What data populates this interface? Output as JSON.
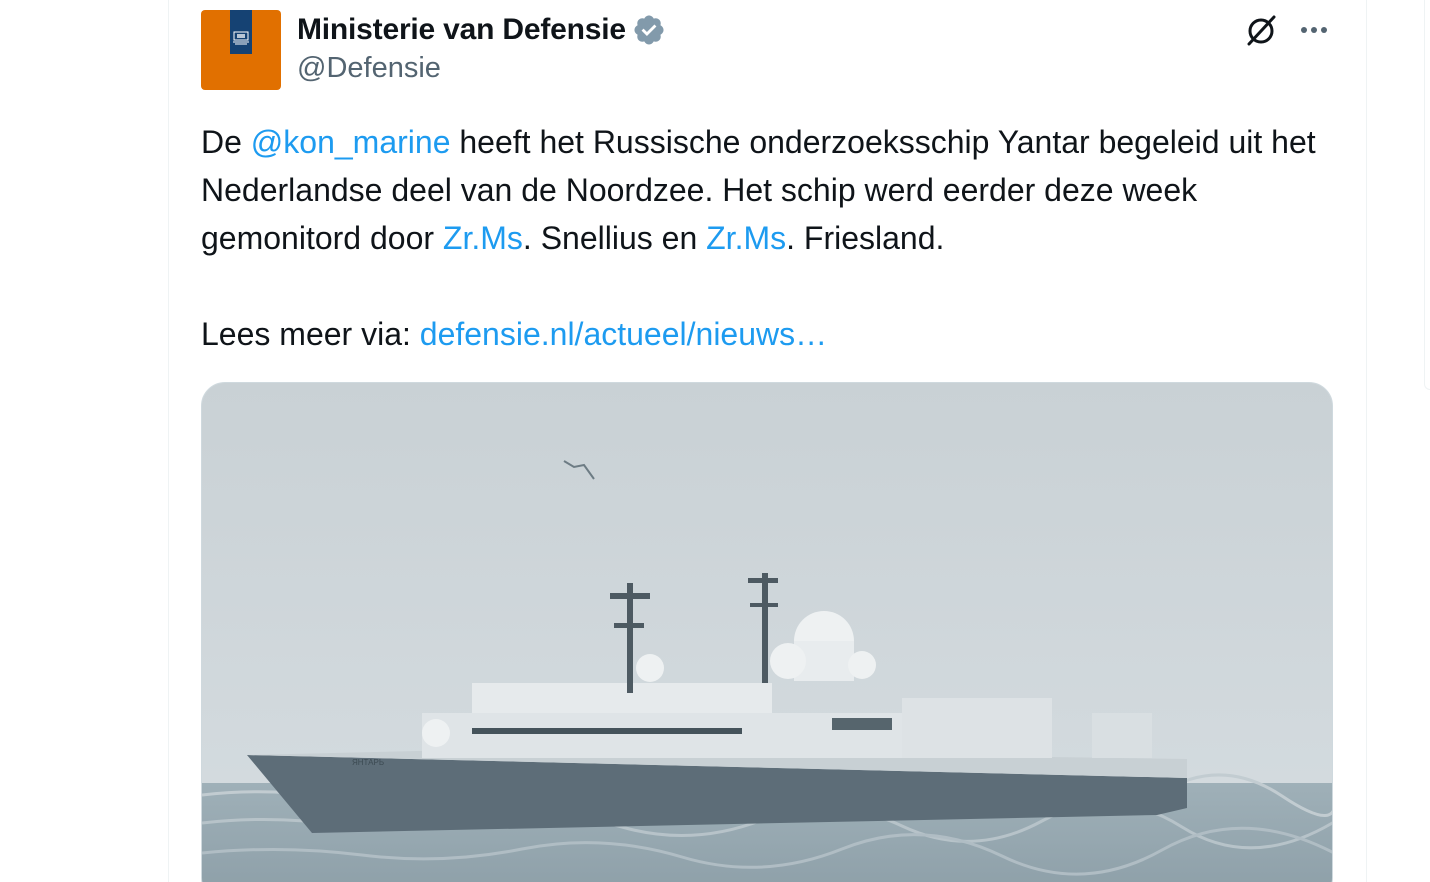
{
  "author": {
    "display_name": "Ministerie van Defensie",
    "handle": "@Defensie",
    "verified_icon": "verified-badge-icon",
    "avatar_color": "#e17000",
    "avatar_band_color": "#154273"
  },
  "actions": {
    "grok_icon": "grok-icon",
    "more_icon": "more-dots-icon"
  },
  "tweet": {
    "t1": "De ",
    "mention": "@kon_marine",
    "t2": " heeft het Russische onderzoeksschip Yantar begeleid uit het Nederlandse deel van de Noordzee. Het schip werd eerder deze week gemonitord door ",
    "link1": "Zr.Ms",
    "t3": ". Snellius en ",
    "link2": "Zr.Ms",
    "t4": ". Friesland.",
    "read_more_prefix": "Lees meer via: ",
    "read_more_link": "defensie.nl/actueel/nieuws…",
    "link_color": "#1d9bf0"
  },
  "media": {
    "hull_name": "ЯНТАРЬ"
  }
}
